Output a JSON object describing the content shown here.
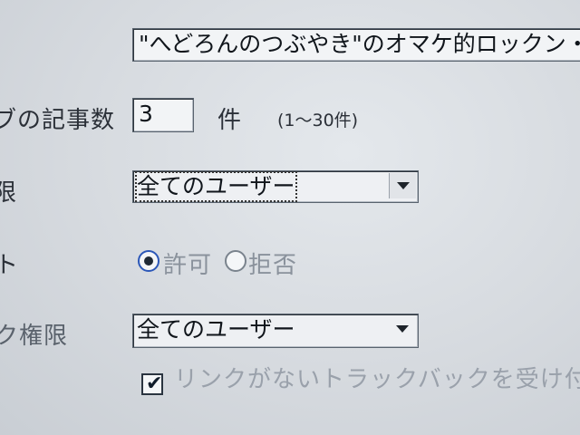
{
  "form": {
    "blog_title_value": "\"へどろんのつぶやき\"のオマケ的ロックン・ロール",
    "article_count": {
      "label": "ブの記事数",
      "value": "3",
      "unit": "件",
      "range": "(1～30件)"
    },
    "permission_row": {
      "label": "限",
      "selected": "全てのユーザー"
    },
    "comment_row": {
      "label": "ト",
      "options": [
        "許可",
        "拒否"
      ],
      "selected": "許可"
    },
    "trackback_row": {
      "label": "ク権限",
      "selected": "全てのユーザー"
    },
    "trackback_no_link": {
      "label": "リンクがないトラックバックを受け付",
      "checked": true
    }
  }
}
